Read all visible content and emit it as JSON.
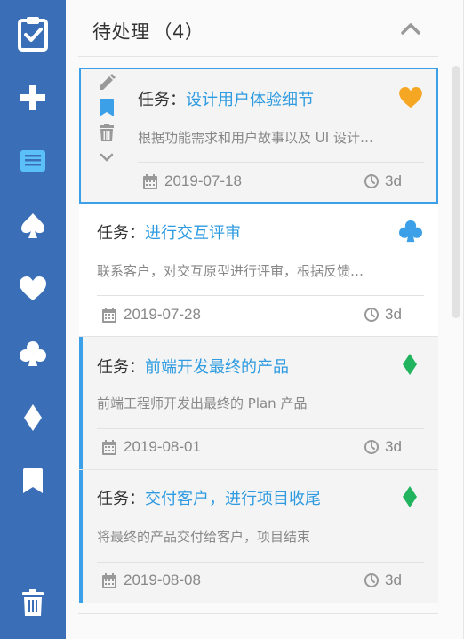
{
  "header": {
    "title": "待处理",
    "count": "（4）"
  },
  "sidebar": {
    "items": [
      {
        "icon": "clipboard-check-icon"
      },
      {
        "icon": "plus-icon"
      },
      {
        "icon": "list-icon",
        "active": true
      },
      {
        "icon": "spade-icon"
      },
      {
        "icon": "heart-icon"
      },
      {
        "icon": "club-icon"
      },
      {
        "icon": "diamond-icon"
      },
      {
        "icon": "bookmark-icon"
      },
      {
        "icon": "trash-icon"
      }
    ]
  },
  "cards": [
    {
      "prefix": "任务：",
      "name": "设计用户体验细节",
      "desc": "根据功能需求和用户故事以及 UI 设计…",
      "date": "2019-07-18",
      "estimate": "3d",
      "suit": "heart",
      "suit_color": "#f5a623"
    },
    {
      "prefix": "任务：",
      "name": "进行交互评审",
      "desc": "联系客户，对交互原型进行评审，根据反馈…",
      "date": "2019-07-28",
      "estimate": "3d",
      "suit": "club",
      "suit_color": "#3ba0e8"
    },
    {
      "prefix": "任务：",
      "name": "前端开发最终的产品",
      "desc": "前端工程师开发出最终的 Plan 产品",
      "date": "2019-08-01",
      "estimate": "3d",
      "suit": "diamond",
      "suit_color": "#22b35e"
    },
    {
      "prefix": "任务：",
      "name": "交付客户，进行项目收尾",
      "desc": "将最终的产品交付给客户，项目结束",
      "date": "2019-08-08",
      "estimate": "3d",
      "suit": "diamond",
      "suit_color": "#22b35e"
    }
  ],
  "colors": {
    "sidebar_bg": "#3a6fb8",
    "accent": "#3ba0e8",
    "active_icon": "#5bc0f8"
  }
}
